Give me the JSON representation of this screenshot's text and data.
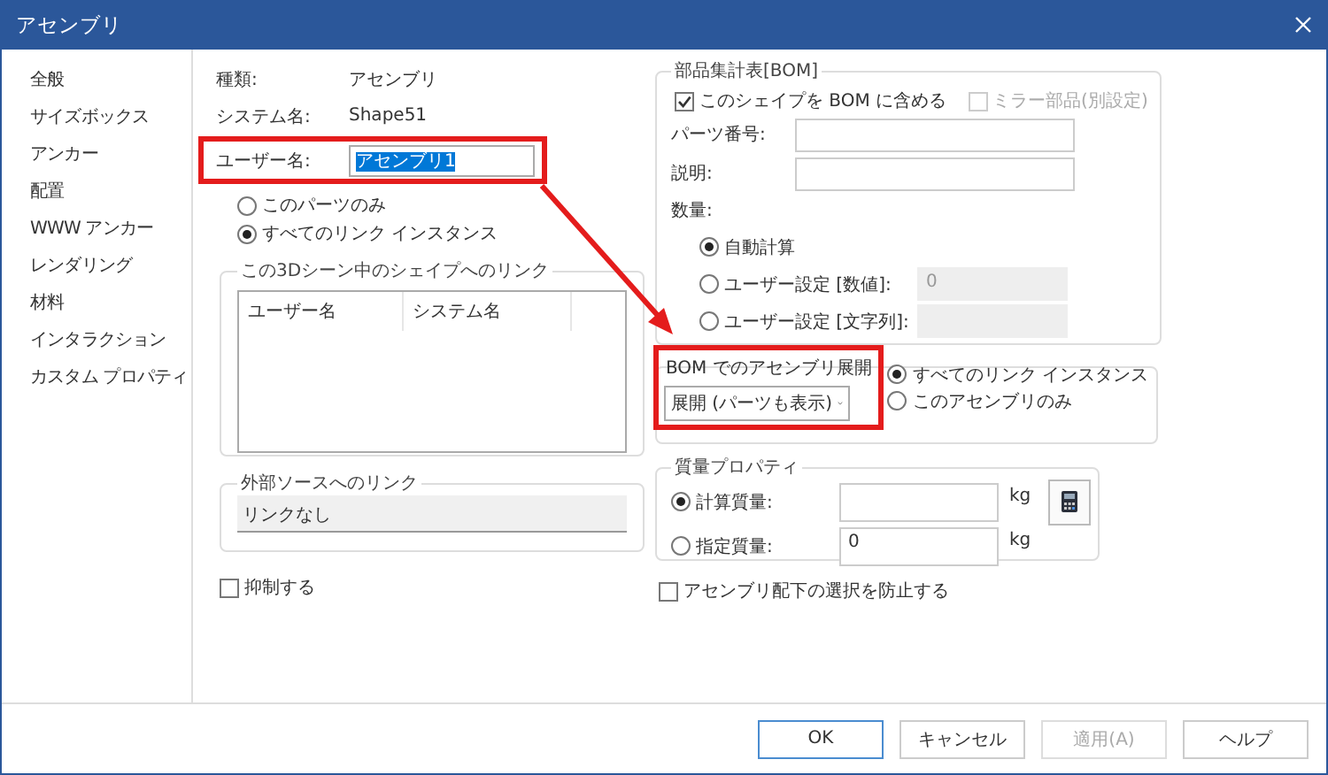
{
  "window": {
    "title": "アセンブリ"
  },
  "sidebar": {
    "items": [
      {
        "label": "全般",
        "selected": false
      },
      {
        "label": "サイズボックス",
        "selected": false
      },
      {
        "label": "アンカー",
        "selected": false
      },
      {
        "label": "配置",
        "selected": false
      },
      {
        "label": "WWW アンカー",
        "selected": false
      },
      {
        "label": "レンダリング",
        "selected": false
      },
      {
        "label": "材料",
        "selected": false
      },
      {
        "label": "インタラクション",
        "selected": false
      },
      {
        "label": "カスタム プロパティ",
        "selected": false
      }
    ]
  },
  "general": {
    "fields": [
      {
        "label": "種類:",
        "value": "アセンブリ"
      },
      {
        "label": "システム名:",
        "value": "Shape51"
      }
    ],
    "user_name": {
      "label": "ユーザー名:",
      "value": "アセンブリ1",
      "text_selected": true,
      "highlighted": true
    },
    "scope_options": [
      {
        "label": "このパーツのみ",
        "selected": false
      },
      {
        "label": "すべてのリンク インスタンス",
        "selected": true
      }
    ],
    "links": {
      "title": "この3Dシーン中のシェイプへのリンク",
      "columns": [
        "ユーザー名",
        "システム名"
      ]
    },
    "external": {
      "title": "外部ソースへのリンク",
      "value": "リンクなし"
    },
    "suppress": {
      "label": "抑制する",
      "checked": false
    }
  },
  "bom": {
    "title": "部品集計表[BOM]",
    "include": {
      "label": "このシェイプを BOM に含める",
      "checked": true,
      "disabled": false
    },
    "mirror": {
      "label": "ミラー部品(別設定)",
      "checked": false,
      "disabled": true
    },
    "part_number": {
      "label": "パーツ番号:"
    },
    "description": {
      "label": "説明:"
    },
    "quantity_label": "数量:",
    "quantity_options": [
      {
        "label": "自動計算",
        "selected": true
      },
      {
        "label": "ユーザー設定 [数値]:",
        "selected": false,
        "field": {
          "value": "0",
          "disabled": true
        }
      },
      {
        "label": "ユーザー設定 [文字列]:",
        "selected": false,
        "field": {
          "disabled": true
        }
      }
    ]
  },
  "expansion": {
    "title": "BOM でのアセンブリ展開",
    "dropdown": "展開 (パーツも表示)",
    "highlighted": true,
    "options": [
      {
        "label": "すべてのリンク インスタンス",
        "selected": true
      },
      {
        "label": "このアセンブリのみ",
        "selected": false
      }
    ]
  },
  "mass": {
    "title": "質量プロパティ",
    "options": [
      {
        "label": "計算質量:",
        "selected": true,
        "unit": "kg"
      },
      {
        "label": "指定質量:",
        "selected": false,
        "value": "0",
        "unit": "kg"
      }
    ]
  },
  "prevent_selection": {
    "label": "アセンブリ配下の選択を防止する",
    "checked": false
  },
  "arrow": true,
  "buttons": [
    {
      "label": "OK",
      "default": true,
      "disabled": false
    },
    {
      "label": "キャンセル",
      "default": false,
      "disabled": false
    },
    {
      "label": "適用(A)",
      "default": false,
      "disabled": true
    },
    {
      "label": "ヘルプ",
      "default": false,
      "disabled": false
    }
  ]
}
